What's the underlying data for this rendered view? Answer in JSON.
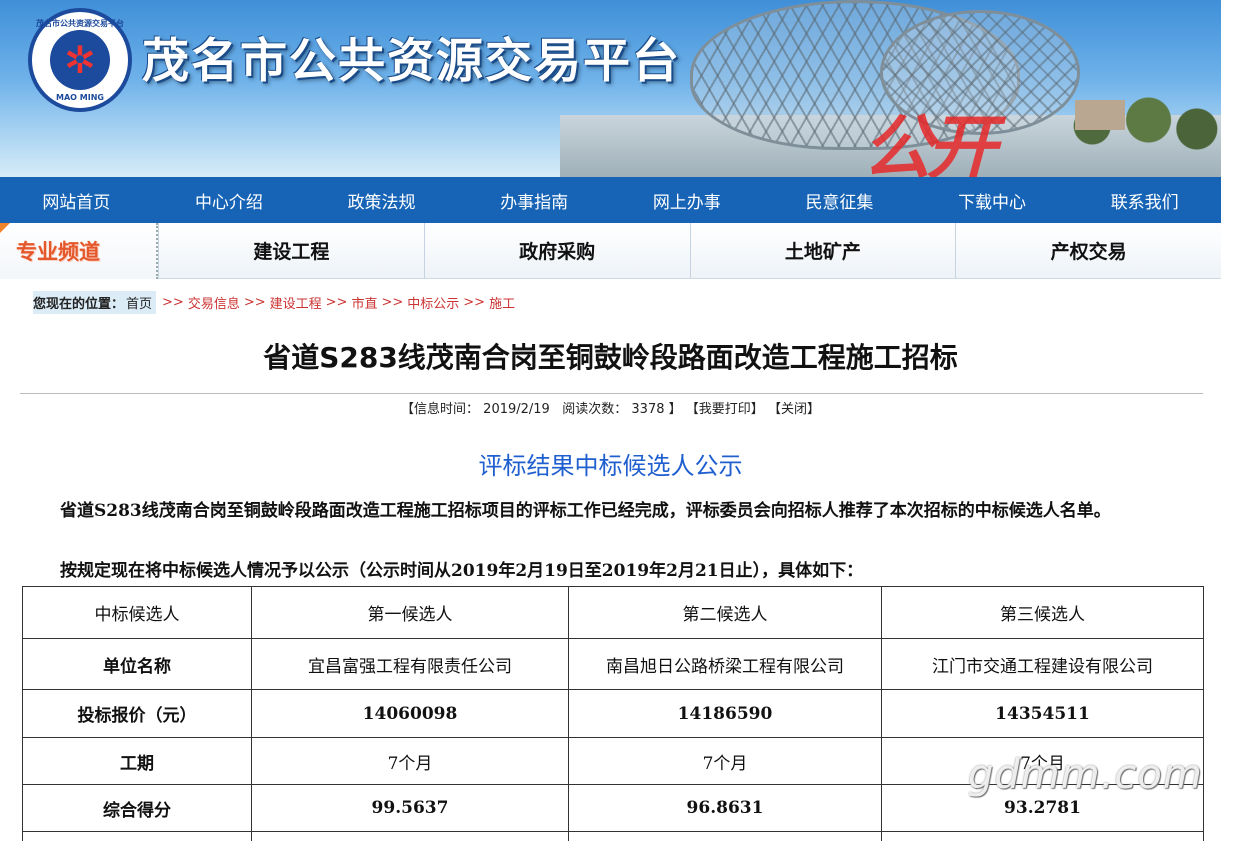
{
  "banner": {
    "site_title": "茂名市公共资源交易平台",
    "logo_top_text": "茂名市公共资源交易平台",
    "logo_bottom_text": "MAO MING",
    "overlay_text": "公开"
  },
  "main_nav": [
    "网站首页",
    "中心介绍",
    "政策法规",
    "办事指南",
    "网上办事",
    "民意征集",
    "下载中心",
    "联系我们"
  ],
  "channel": {
    "label": "专业频道",
    "tabs": [
      "建设工程",
      "政府采购",
      "土地矿产",
      "产权交易"
    ]
  },
  "breadcrumb": {
    "prefix": "您现在的位置：",
    "home": "首页",
    "separator": ">>",
    "items": [
      "交易信息",
      "建设工程",
      "市直",
      "中标公示",
      "施工"
    ]
  },
  "article": {
    "title": "省道S283线茂南合岗至铜鼓岭段路面改造工程施工招标",
    "meta": {
      "info_time_label": "【信息时间：",
      "info_time": "2019/2/19",
      "reads_label": "阅读次数：",
      "reads": "3378",
      "reads_close": "】",
      "print": "【我要打印】",
      "close": "【关闭】"
    },
    "sub_title": "评标结果中标候选人公示",
    "para1": "省道S283线茂南合岗至铜鼓岭段路面改造工程施工招标项目的评标工作已经完成，评标委员会向招标人推荐了本次招标的中标候选人名单。",
    "para2": "按规定现在将中标候选人情况予以公示（公示时间从2019年2月19日至2019年2月21日止），具体如下："
  },
  "table": {
    "header": [
      "中标候选人",
      "第一候选人",
      "第二候选人",
      "第三候选人"
    ],
    "rows": [
      {
        "label": "单位名称",
        "values": [
          "宜昌富强工程有限责任公司",
          "南昌旭日公路桥梁工程有限公司",
          "江门市交通工程建设有限公司"
        ]
      },
      {
        "label": "投标报价（元）",
        "values": [
          "14060098",
          "14186590",
          "14354511"
        ]
      },
      {
        "label": "工期",
        "values": [
          "7个月",
          "7个月",
          "7个月"
        ]
      },
      {
        "label": "综合得分",
        "values": [
          "99.5637",
          "96.8631",
          "93.2781"
        ]
      }
    ]
  },
  "watermark": "gdmm.com",
  "colors": {
    "nav_bg": "#1764b6",
    "subtitle_blue": "#1f5fcf",
    "breadcrumb_red": "#cc3333",
    "channel_label": "#e4572b"
  }
}
